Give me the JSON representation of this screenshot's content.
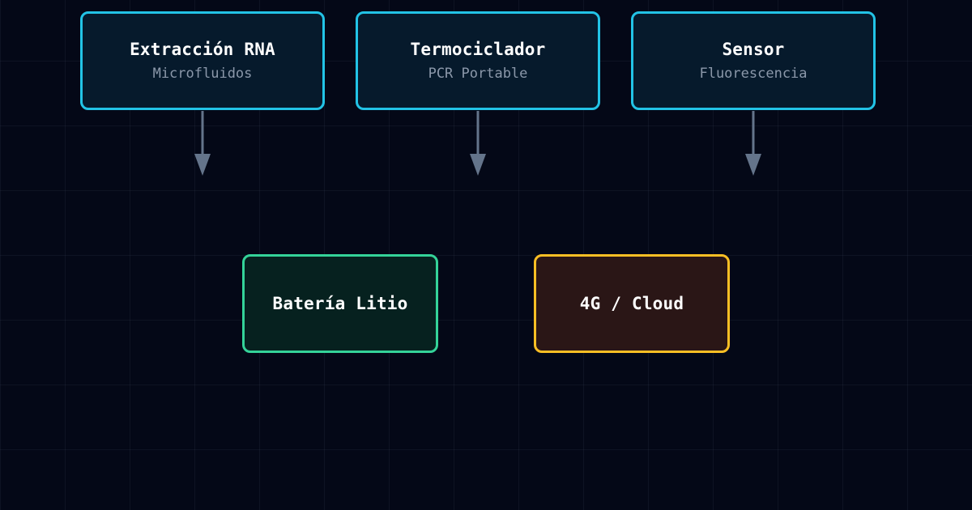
{
  "diagram": {
    "nodes": [
      {
        "id": "rna",
        "title": "Extracción RNA",
        "subtitle": "Microfluidos",
        "color": "#22c3e6"
      },
      {
        "id": "pcr",
        "title": "Termociclador",
        "subtitle": "PCR Portable",
        "color": "#22c3e6"
      },
      {
        "id": "sensor",
        "title": "Sensor",
        "subtitle": "Fluorescencia",
        "color": "#22c3e6"
      },
      {
        "id": "battery",
        "title": "Batería Litio",
        "color": "#34d399"
      },
      {
        "id": "cloud",
        "title": "4G / Cloud",
        "color": "#fbbf24"
      }
    ],
    "edges": [
      {
        "from": "rna"
      },
      {
        "from": "pcr"
      },
      {
        "from": "sensor"
      }
    ],
    "colors": {
      "background": "#040817",
      "arrow": "#64748b"
    }
  }
}
